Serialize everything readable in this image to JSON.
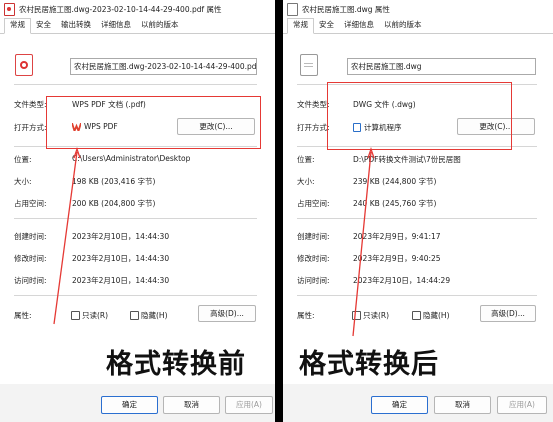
{
  "left": {
    "title": "农村民居施工图.dwg-2023-02-10-14-44-29-400.pdf 属性",
    "tabs": [
      "常规",
      "安全",
      "输出转换",
      "详细信息",
      "以前的版本"
    ],
    "filename": "农村民居施工图.dwg-2023-02-10-14-44-29-400.pdf",
    "labels": {
      "type": "文件类型:",
      "open": "打开方式:",
      "location": "位置:",
      "size": "大小:",
      "disk": "占用空间:",
      "created": "创建时间:",
      "modified": "修改时间:",
      "accessed": "访问时间:",
      "attributes": "属性:"
    },
    "type_value": "WPS PDF 文档 (.pdf)",
    "open_app": "WPS PDF",
    "change_button": "更改(C)...",
    "location_value": "C:\\Users\\Administrator\\Desktop",
    "size_value": "198 KB (203,416 字节)",
    "disk_value": "200 KB (204,800 字节)",
    "created_value": "2023年2月10日，14:44:30",
    "modified_value": "2023年2月10日，14:44:30",
    "accessed_value": "2023年2月10日，14:44:30",
    "readonly": "只读(R)",
    "hidden": "隐藏(H)",
    "advanced": "高级(D)...",
    "caption": "格式转换前",
    "ok": "确定",
    "cancel": "取消",
    "apply": "应用(A)"
  },
  "right": {
    "title": "农村民居施工图.dwg 属性",
    "tabs": [
      "常规",
      "安全",
      "详细信息",
      "以前的版本"
    ],
    "filename": "农村民居施工图.dwg",
    "labels": {
      "type": "文件类型:",
      "open": "打开方式:",
      "location": "位置:",
      "size": "大小:",
      "disk": "占用空间:",
      "created": "创建时间:",
      "modified": "修改时间:",
      "accessed": "访问时间:",
      "attributes": "属性:"
    },
    "type_value": "DWG 文件 (.dwg)",
    "open_app": "计算机程序",
    "change_button": "更改(C)...",
    "location_value": "D:\\PDF转换文件测试\\7份民居图",
    "size_value": "239 KB (244,800 字节)",
    "disk_value": "240 KB (245,760 字节)",
    "created_value": "2023年2月9日，9:41:17",
    "modified_value": "2023年2月9日，9:40:25",
    "accessed_value": "2023年2月10日，14:44:29",
    "readonly": "只读(R)",
    "hidden": "隐藏(H)",
    "advanced": "高级(D)...",
    "caption": "格式转换后",
    "ok": "确定",
    "cancel": "取消",
    "apply": "应用(A)"
  },
  "colors": {
    "highlight": "#e53935",
    "primary_border": "#2b6fd0"
  }
}
